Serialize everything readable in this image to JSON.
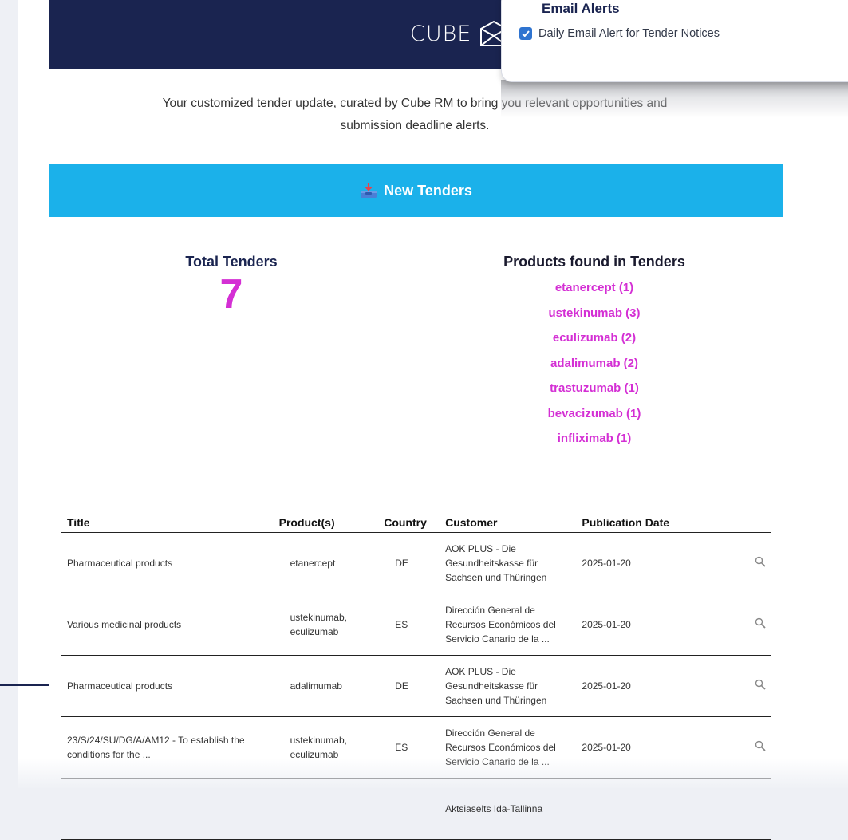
{
  "header": {
    "logo_text": "CUBE"
  },
  "intro": {
    "line1": "Your customized tender update, curated by Cube RM to bring you relevant opportunities and",
    "line2": "submission deadline alerts."
  },
  "section": {
    "icon": "inbox-tray-icon",
    "label": "New Tenders",
    "color": "#1bb1ea"
  },
  "summary": {
    "total_label": "Total Tenders",
    "total_value": "7",
    "products_label": "Products found in Tenders",
    "products": [
      "etanercept (1)",
      "ustekinumab (3)",
      "eculizumab (2)",
      "adalimumab (2)",
      "trastuzumab (1)",
      "bevacizumab (1)",
      "infliximab (1)"
    ],
    "accent_color": "#d42fd4"
  },
  "table": {
    "headers": [
      "Title",
      "Product(s)",
      "Country",
      "Customer",
      "Publication Date"
    ],
    "rows": [
      {
        "title": "Pharmaceutical products",
        "products": "etanercept",
        "country": "DE",
        "customer": "AOK PLUS - Die Gesundheitskasse für Sachsen und Thüringen",
        "date": "2025-01-20"
      },
      {
        "title": "Various medicinal products",
        "products": "ustekinumab, eculizumab",
        "country": "ES",
        "customer": "Dirección General de Recursos Económicos del Servicio Canario de la ...",
        "date": "2025-01-20"
      },
      {
        "title": "Pharmaceutical products",
        "products": "adalimumab",
        "country": "DE",
        "customer": "AOK PLUS - Die Gesundheitskasse für Sachsen und Thüringen",
        "date": "2025-01-20"
      },
      {
        "title": "23/S/24/SU/DG/A/AM12 - To establish the conditions for the ...",
        "products": "ustekinumab, eculizumab",
        "country": "ES",
        "customer": "Dirección General de Recursos Económicos del Servicio Canario de la ...",
        "date": "2025-01-20"
      },
      {
        "title": "",
        "products": "",
        "country": "",
        "customer": "Aktsiaselts Ida-Tallinna",
        "date": ""
      }
    ]
  },
  "email_alerts": {
    "title": "Email Alerts",
    "option_label": "Daily Email Alert for Tender Notices",
    "checked": true
  }
}
